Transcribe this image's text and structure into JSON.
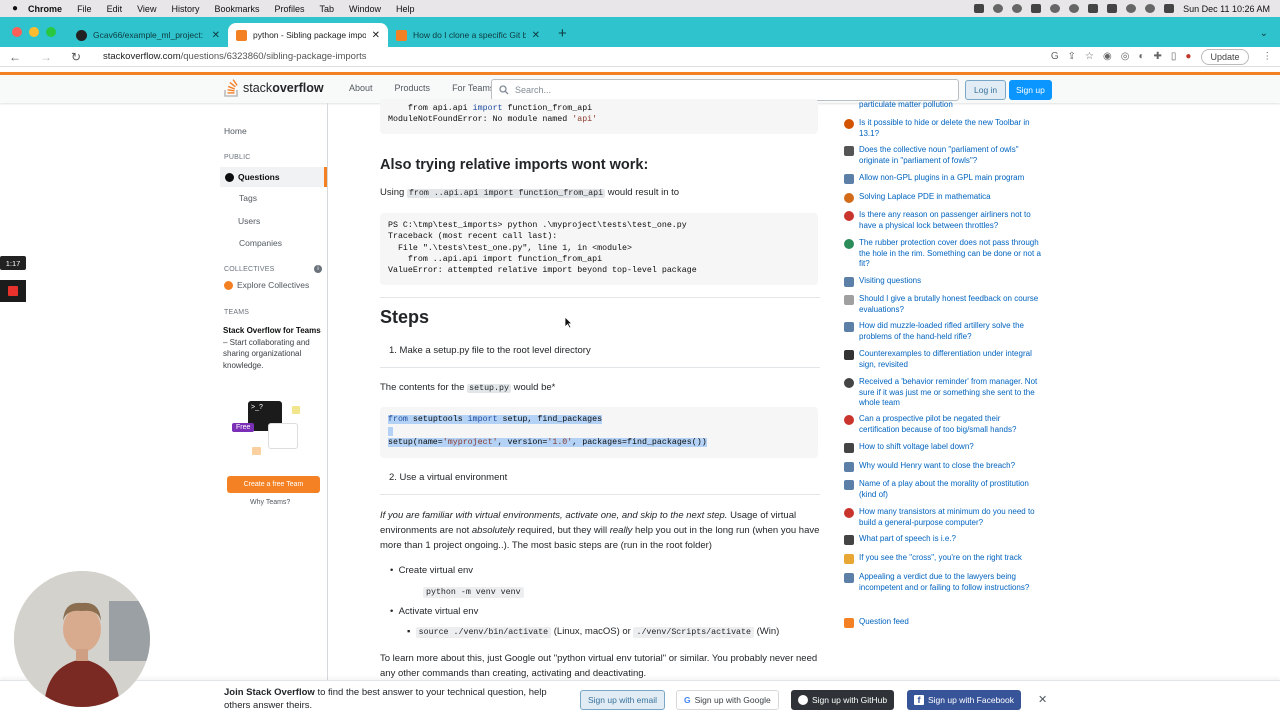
{
  "menubar": {
    "apple": "",
    "app": "Chrome",
    "items": [
      "File",
      "Edit",
      "View",
      "History",
      "Bookmarks",
      "Profiles",
      "Tab",
      "Window",
      "Help"
    ],
    "datetime": "Sun Dec 11  10:26 AM"
  },
  "tabs": [
    {
      "title": "Gcav66/example_ml_project: ",
      "favicon": "github-icon",
      "active": false
    },
    {
      "title": "python - Sibling package impo",
      "favicon": "stackoverflow-icon",
      "active": true
    },
    {
      "title": "How do I clone a specific Git b",
      "favicon": "stackoverflow-icon",
      "active": false
    }
  ],
  "address": {
    "host": "stackoverflow.com",
    "path": "/questions/6323860/sibling-package-imports",
    "update_label": "Update"
  },
  "so_header": {
    "logo_text_light": "stack",
    "logo_text_bold": "overflow",
    "nav": [
      "About",
      "Products",
      "For Teams"
    ],
    "search_placeholder": "Search...",
    "login": "Log in",
    "signup": "Sign up"
  },
  "left_nav": {
    "home": "Home",
    "public": "PUBLIC",
    "questions": "Questions",
    "tags": "Tags",
    "users": "Users",
    "companies": "Companies",
    "collectives": "COLLECTIVES",
    "explore_collectives": "Explore Collectives",
    "teams": "TEAMS",
    "teams_title": "Stack Overflow for Teams",
    "teams_desc": " – Start collaborating and sharing organizational knowledge.",
    "free_badge": "Free",
    "create_team": "Create a free Team",
    "why_teams": "Why Teams?"
  },
  "main": {
    "code1_line1_pre": "    from api.api ",
    "code1_line1_kw": "import",
    "code1_line1_post": " function_from_api",
    "code1_line2_pre": "ModuleNotFoundError: No module named ",
    "code1_line2_str": "'api'",
    "heading_relative": "Also trying relative imports wont work:",
    "using_pre": "Using ",
    "using_code": "from ..api.api import function_from_api",
    "using_post": " would result in to",
    "code2": [
      "PS C:\\tmp\\test_imports> python .\\myproject\\tests\\test_one.py",
      "Traceback (most recent call last):",
      "  File \".\\tests\\test_one.py\", line 1, in <module>",
      "    from ..api.api import function_from_api",
      "ValueError: attempted relative import beyond top-level package"
    ],
    "steps_heading": "Steps",
    "step1": "1. Make a setup.py file to the root level directory",
    "contents_pre": "The contents for the ",
    "contents_code": "setup.py",
    "contents_post": " would be*",
    "code3_line1_kw1": "from",
    "code3_line1_mid": " setuptools ",
    "code3_line1_kw2": "import",
    "code3_line1_post": " setup, find_packages",
    "code3_line2_pre": "setup(name=",
    "code3_line2_str1": "'myproject'",
    "code3_line2_mid": ", version=",
    "code3_line2_str2": "'1.0'",
    "code3_line2_post": ", packages=find_packages())",
    "step2": "2. Use a virtual environment",
    "para_italic1": "If you are familiar with virtual environments, activate one, and skip to the next step.",
    "para_text1": " Usage of virtual environments are not ",
    "para_italic2": "absolutely",
    "para_text2": " required, but they will ",
    "para_italic3": "really",
    "para_text3": " help you out in the long run (when you have more than 1 project ongoing..). The most basic steps are (run in the root folder)",
    "bullet_create": "Create virtual env",
    "cmd_create": "python -m venv venv",
    "bullet_activate": "Activate virtual env",
    "cmd_activate_unix": "source ./venv/bin/activate",
    "activate_unix_note": " (Linux, macOS) or ",
    "cmd_activate_win": "./venv/Scripts/activate",
    "activate_win_note": " (Win)",
    "learn_more": "To learn more about this, just Google out \"python virtual env tutorial\" or similar. You probably never need any other commands than creating, activating and deactivating."
  },
  "hot_questions": [
    {
      "text": "particulate matter pollution",
      "icon_color": "#c0c0c0"
    },
    {
      "text": "Is it possible to hide or delete the new Toolbar in 13.1?",
      "icon_color": "#d35400"
    },
    {
      "text": "Does the collective noun \"parliament of owls\" originate in \"parliament of fowls\"?",
      "icon_color": "#555555"
    },
    {
      "text": "Allow non-GPL plugins in a GPL main program",
      "icon_color": "#5b7fa6"
    },
    {
      "text": "Solving Laplace PDE in mathematica",
      "icon_color": "#d36b1a"
    },
    {
      "text": "Is there any reason on passenger airliners not to have a physical lock between throttles?",
      "icon_color": "#c9342d"
    },
    {
      "text": "The rubber protection cover does not pass through the hole in the rim. Something can be done or not a fit?",
      "icon_color": "#2b8c5a"
    },
    {
      "text": "Visiting questions",
      "icon_color": "#5b7fa6"
    },
    {
      "text": "Should I give a brutally honest feedback on course evaluations?",
      "icon_color": "#a0a0a0"
    },
    {
      "text": "How did muzzle-loaded rifled artillery solve the problems of the hand-held rifle?",
      "icon_color": "#5b7fa6"
    },
    {
      "text": "Counterexamples to differentiation under integral sign, revisited",
      "icon_color": "#333333"
    },
    {
      "text": "Received a 'behavior reminder' from manager. Not sure if it was just me or something she sent to the whole team",
      "icon_color": "#444444"
    },
    {
      "text": "Can a prospective pilot be negated their certification because of too big/small hands?",
      "icon_color": "#c9342d"
    },
    {
      "text": "How to shift voltage label down?",
      "icon_color": "#444444"
    },
    {
      "text": "Why would Henry want to close the breach?",
      "icon_color": "#5b7fa6"
    },
    {
      "text": "Name of a play about the morality of prostitution (kind of)",
      "icon_color": "#5b7fa6"
    },
    {
      "text": "How many transistors at minimum do you need to build a general-purpose computer?",
      "icon_color": "#c9342d"
    },
    {
      "text": "What part of speech is i.e.?",
      "icon_color": "#444444"
    },
    {
      "text": "If you see the \"cross\", you're on the right track",
      "icon_color": "#e8a735"
    },
    {
      "text": "Appealing a verdict due to the lawyers being incompetent and or failing to follow instructions?",
      "icon_color": "#5b7fa6"
    }
  ],
  "question_feed": "Question feed",
  "recorder": {
    "timer": "1:17"
  },
  "banner": {
    "bold": "Join Stack Overflow",
    "text": " to find the best answer to your technical question, help others answer theirs.",
    "email": "Sign up with email",
    "google": "Sign up with Google",
    "github": "Sign up with GitHub",
    "facebook": "Sign up with Facebook",
    "close": "✕"
  },
  "colors": {
    "accent": "#f48024",
    "link": "#0063bf",
    "primary": "#0a95ff",
    "tabstrip": "#2fc3cd"
  }
}
